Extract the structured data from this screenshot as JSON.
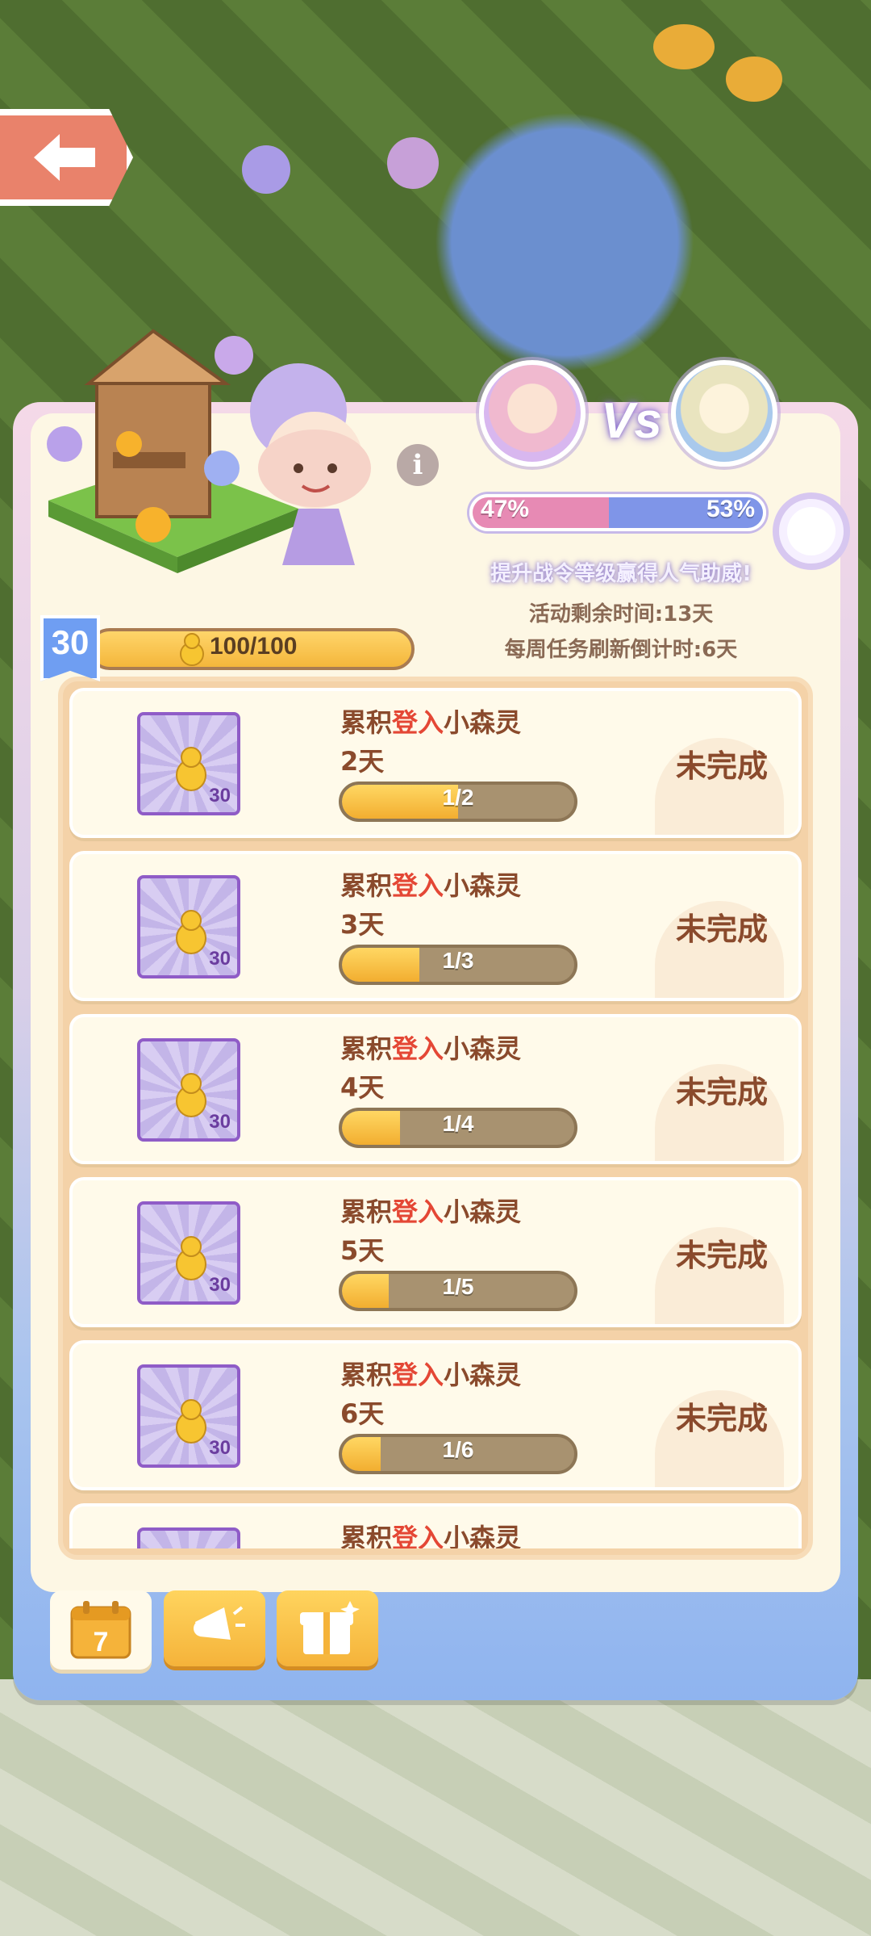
{
  "header": {
    "back_icon": "back-arrow-icon",
    "info_icon": "info-icon"
  },
  "vs": {
    "label": "Vs",
    "left_pct": "47%",
    "right_pct": "53%",
    "left_value": 47,
    "right_value": 53,
    "promo": "提升战令等级赢得人气助威!",
    "remaining_time": "活动剩余时间:13天",
    "weekly_refresh": "每周任务刷新倒计时:6天"
  },
  "level": {
    "number": "30",
    "progress_text": "100/100",
    "progress_value": 1.0
  },
  "tasks": [
    {
      "title_prefix": "累积",
      "title_highlight": "登入",
      "title_suffix": "小森灵",
      "days": "2天",
      "progress": "1/2",
      "progress_value": 0.5,
      "status": "未完成",
      "reward": "30"
    },
    {
      "title_prefix": "累积",
      "title_highlight": "登入",
      "title_suffix": "小森灵",
      "days": "3天",
      "progress": "1/3",
      "progress_value": 0.333,
      "status": "未完成",
      "reward": "30"
    },
    {
      "title_prefix": "累积",
      "title_highlight": "登入",
      "title_suffix": "小森灵",
      "days": "4天",
      "progress": "1/4",
      "progress_value": 0.25,
      "status": "未完成",
      "reward": "30"
    },
    {
      "title_prefix": "累积",
      "title_highlight": "登入",
      "title_suffix": "小森灵",
      "days": "5天",
      "progress": "1/5",
      "progress_value": 0.2,
      "status": "未完成",
      "reward": "30"
    },
    {
      "title_prefix": "累积",
      "title_highlight": "登入",
      "title_suffix": "小森灵",
      "days": "6天",
      "progress": "1/6",
      "progress_value": 0.167,
      "status": "未完成",
      "reward": "30"
    },
    {
      "title_prefix": "累积",
      "title_highlight": "登入",
      "title_suffix": "小森灵",
      "days": "",
      "progress": "",
      "progress_value": 0,
      "status": "",
      "reward": ""
    }
  ],
  "tabs": [
    {
      "icon": "calendar-icon",
      "label": "7",
      "active": true
    },
    {
      "icon": "megaphone-icon",
      "active": false
    },
    {
      "icon": "gift-box-icon",
      "active": false
    }
  ],
  "colors": {
    "accent_orange": "#f4b63b",
    "highlight_red": "#e44735",
    "vs_pink": "#e78ab4",
    "vs_blue": "#7f95e8"
  }
}
